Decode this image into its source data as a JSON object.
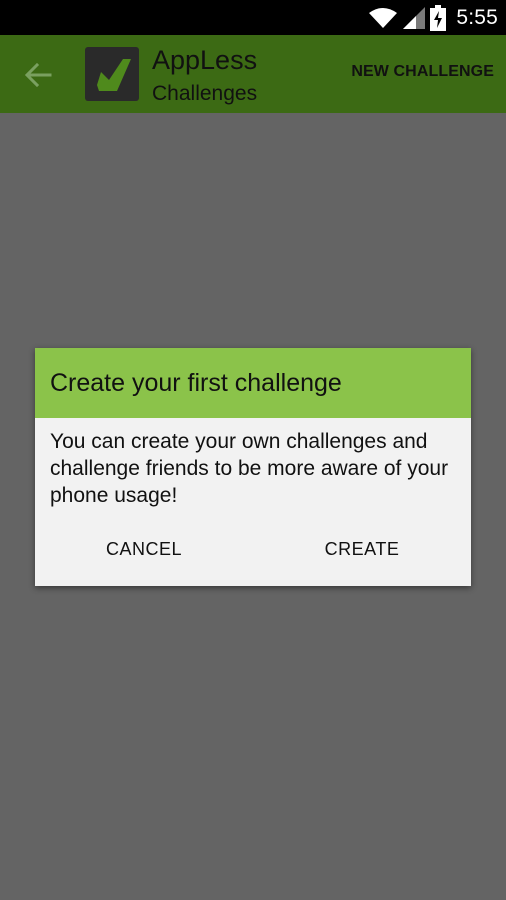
{
  "status_bar": {
    "time": "5:55",
    "icons": [
      "wifi-icon",
      "signal-icon",
      "battery-charging-icon"
    ]
  },
  "action_bar": {
    "back_icon": "arrow-back-icon",
    "logo_icon": "appless-logo",
    "title": "AppLess",
    "subtitle": "Challenges",
    "action_label": "NEW CHALLENGE",
    "color": "#3c6a14"
  },
  "dialog": {
    "title": "Create your first challenge",
    "message": "You can create your own challenges and challenge friends to be more aware of your phone usage!",
    "cancel_label": "CANCEL",
    "create_label": "CREATE",
    "header_color": "#8bc34a"
  }
}
